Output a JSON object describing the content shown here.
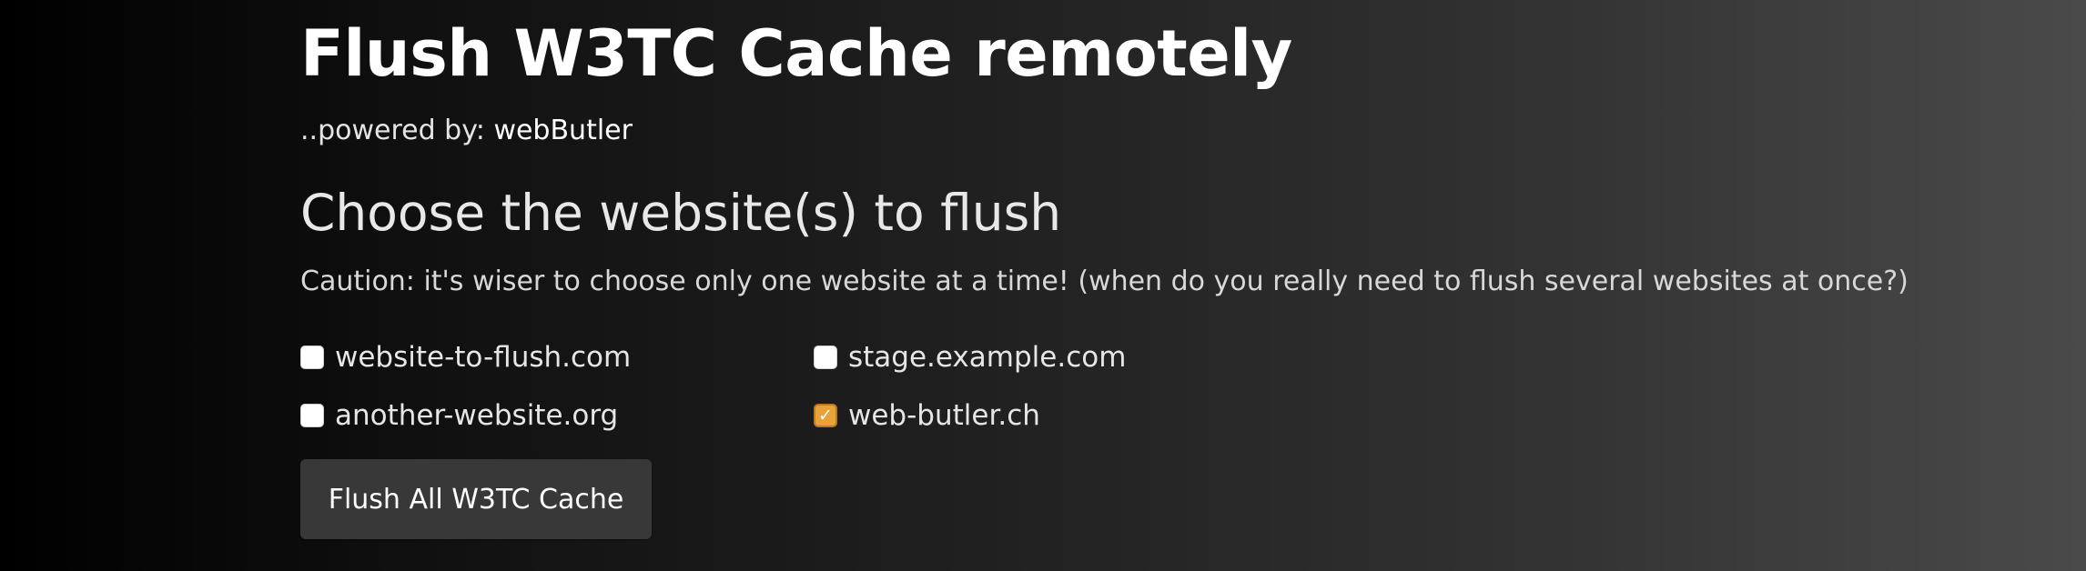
{
  "header": {
    "title": "Flush W3TC Cache remotely",
    "powered_prefix": "..powered by: ",
    "powered_brand": "webButler"
  },
  "selection": {
    "heading": "Choose the website(s) to flush",
    "caution": "Caution: it's wiser to choose only one website at a time! (when do you really need to flush several websites at once?)",
    "sites": [
      {
        "label": "website-to-flush.com",
        "checked": false
      },
      {
        "label": "stage.example.com",
        "checked": false
      },
      {
        "label": "another-website.org",
        "checked": false
      },
      {
        "label": "web-butler.ch",
        "checked": true
      }
    ],
    "checked_color": "#e8a23a"
  },
  "actions": {
    "flush_label": "Flush All W3TC Cache"
  }
}
